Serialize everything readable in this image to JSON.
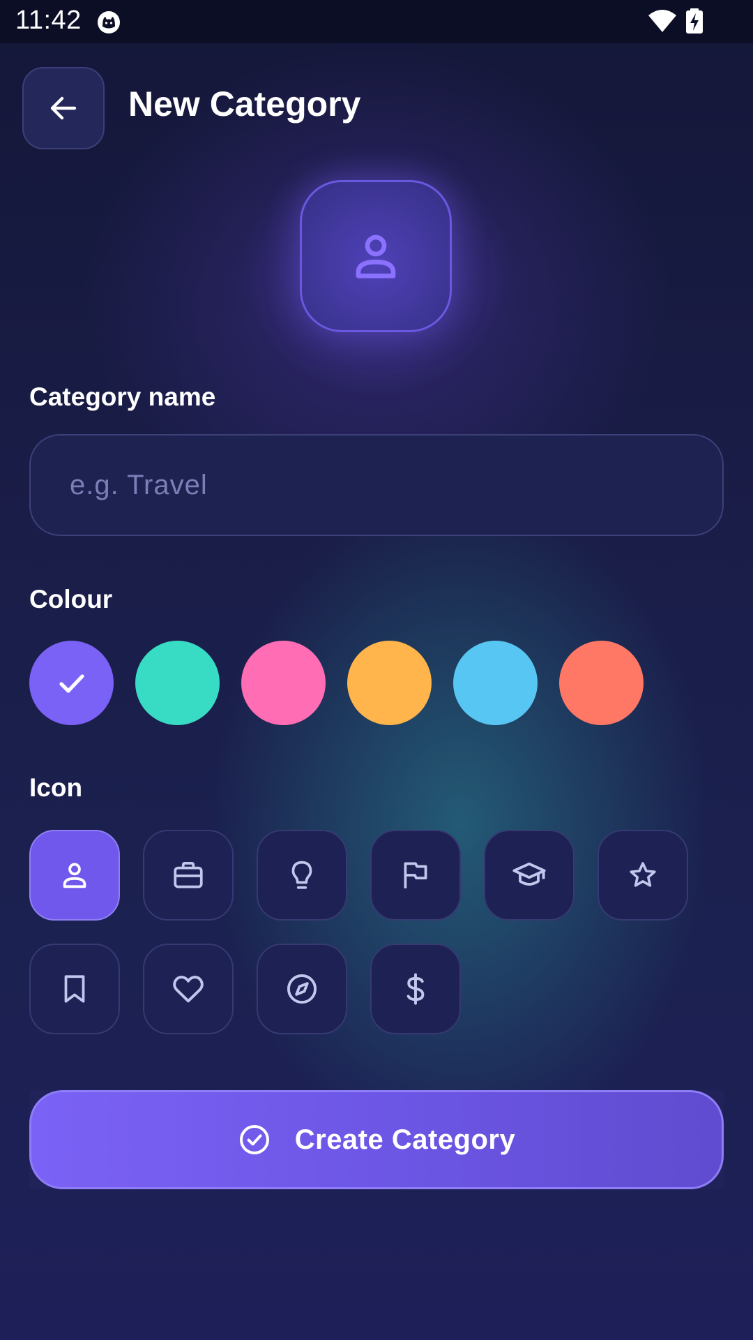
{
  "status_bar": {
    "time": "11:42"
  },
  "header": {
    "title": "New Category"
  },
  "preview": {
    "icon": "person-icon",
    "accent": "#7b62f6"
  },
  "name_section": {
    "label": "Category name",
    "value": "",
    "placeholder": "e.g. Travel"
  },
  "colour_section": {
    "label": "Colour",
    "selected": "#7b62f6",
    "swatches": [
      {
        "color": "#7b62f6",
        "selected": true
      },
      {
        "color": "#38dcc4",
        "selected": false
      },
      {
        "color": "#ff6eb4",
        "selected": false
      },
      {
        "color": "#ffb54c",
        "selected": false
      },
      {
        "color": "#58c6f2",
        "selected": false
      },
      {
        "color": "#ff7866",
        "selected": false
      }
    ]
  },
  "icon_section": {
    "label": "Icon",
    "icons": [
      {
        "name": "person-icon",
        "selected": true
      },
      {
        "name": "briefcase-icon",
        "selected": false
      },
      {
        "name": "lightbulb-icon",
        "selected": false
      },
      {
        "name": "flag-icon",
        "selected": false
      },
      {
        "name": "graduation-cap-icon",
        "selected": false
      },
      {
        "name": "star-icon",
        "selected": false
      },
      {
        "name": "bookmark-icon",
        "selected": false
      },
      {
        "name": "heart-icon",
        "selected": false
      },
      {
        "name": "compass-icon",
        "selected": false
      },
      {
        "name": "dollar-icon",
        "selected": false
      }
    ]
  },
  "actions": {
    "create_label": "Create Category",
    "create_icon": "check-circle-icon"
  }
}
